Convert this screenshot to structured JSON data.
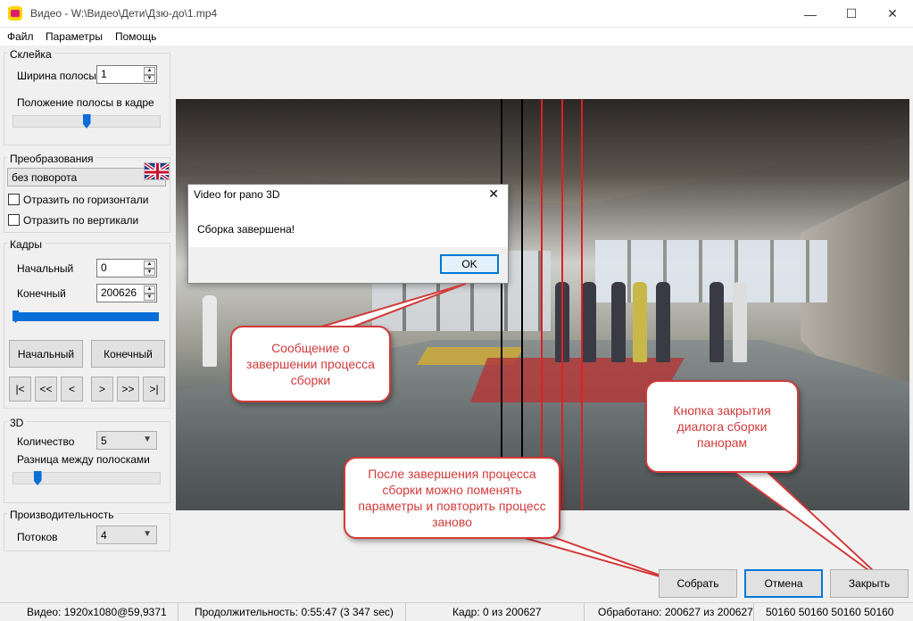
{
  "window": {
    "title": "Видео - W:\\Видео\\Дети\\Дзю-до\\1.mp4",
    "minimize": "—",
    "maximize": "☐",
    "close": "✕"
  },
  "menu": {
    "file": "Файл",
    "params": "Параметры",
    "help": "Помощь"
  },
  "stitch": {
    "title": "Склейка",
    "strip_width_label": "Ширина полосы",
    "strip_width_value": "1",
    "strip_position_label": "Положение полосы в кадре",
    "strip_position_fraction": 0.5
  },
  "transform": {
    "title": "Преобразования",
    "rotation_value": "без поворота",
    "flip_h_label": "Отразить по горизонтали",
    "flip_v_label": "Отразить по вертикали"
  },
  "frames": {
    "title": "Кадры",
    "start_label": "Начальный",
    "start_value": "0",
    "end_label": "Конечный",
    "end_value": "200626",
    "range_start": 0,
    "range_end": 200626,
    "start_button": "Начальный",
    "end_button": "Конечный",
    "nav": [
      "|<",
      "<<",
      "<",
      ">",
      ">>",
      ">|"
    ]
  },
  "three_d": {
    "title": "3D",
    "count_label": "Количество",
    "count_value": "5",
    "diff_label": "Разница между полосками",
    "diff_fraction": 0.15
  },
  "perf": {
    "title": "Производительность",
    "threads_label": "Потоков",
    "threads_value": "4"
  },
  "dialog": {
    "title": "Video for pano 3D",
    "close": "✕",
    "message": "Сборка завершена!",
    "ok": "OK"
  },
  "callouts": {
    "finish_msg": "Сообщение о завершении процесса сборки",
    "close_btn": "Кнопка закрытия диалога сборки панорам",
    "rebuild": "После завершения процесса сборки можно поменять параметры и повторить процесс заново"
  },
  "buttons": {
    "build": "Собрать",
    "cancel": "Отмена",
    "close": "Закрыть"
  },
  "status": {
    "video": "Видео:  1920x1080@59,9371",
    "duration": "Продолжительность: 0:55:47 (3 347 sec)",
    "frame": "Кадр: 0 из 200627",
    "processed": "Обработано: 200627 из 200627",
    "positions": "50160 50160 50160 50160"
  },
  "colors": {
    "accent": "#0078d7",
    "callout": "#d23a3a",
    "slider": "#0a6dd8"
  }
}
